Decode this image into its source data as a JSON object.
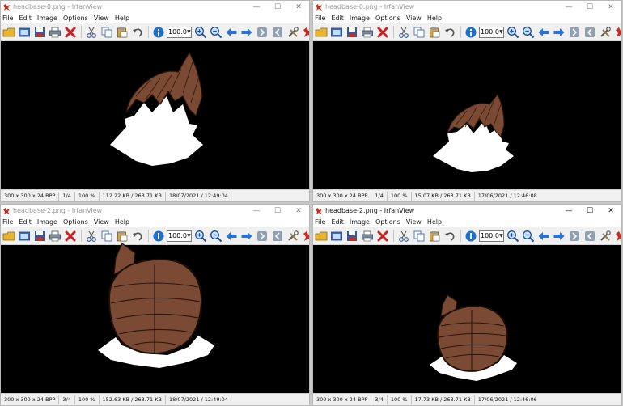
{
  "windows": [
    {
      "title": "headbase-0.png - IrfanView",
      "active": false,
      "menu": [
        "File",
        "Edit",
        "Image",
        "Options",
        "View",
        "Help"
      ],
      "zoom": "100.0",
      "status": {
        "dimensions": "300 x 300 x 24 BPP",
        "index": "1/4",
        "zoom": "100 %",
        "size": "112.22 KB / 263.71 KB",
        "date": "18/07/2021 / 12:49:04"
      }
    },
    {
      "title": "headbase-0.png - IrfanView",
      "active": false,
      "menu": [
        "File",
        "Edit",
        "Image",
        "Options",
        "View",
        "Help"
      ],
      "zoom": "100.0",
      "status": {
        "dimensions": "300 x 300 x 24 BPP",
        "index": "1/4",
        "zoom": "100 %",
        "size": "15.07 KB / 263.71 KB",
        "date": "17/06/2021 / 12:46:08"
      }
    },
    {
      "title": "headbase-2.png - IrfanView",
      "active": false,
      "menu": [
        "File",
        "Edit",
        "Image",
        "Options",
        "View",
        "Help"
      ],
      "zoom": "100.0",
      "status": {
        "dimensions": "300 x 300 x 24 BPP",
        "index": "3/4",
        "zoom": "100 %",
        "size": "152.63 KB / 263.71 KB",
        "date": "18/07/2021 / 12:49:04"
      }
    },
    {
      "title": "headbase-2.png - IrfanView",
      "active": true,
      "menu": [
        "File",
        "Edit",
        "Image",
        "Options",
        "View",
        "Help"
      ],
      "zoom": "100.0",
      "status": {
        "dimensions": "300 x 300 x 24 BPP",
        "index": "3/4",
        "zoom": "100 %",
        "size": "17.73 KB / 263.71 KB",
        "date": "17/06/2021 / 12:46:06"
      }
    }
  ],
  "caption_buttons": {
    "minimize": "—",
    "maximize": "☐",
    "close": "✕"
  },
  "toolbar_icons": [
    "open-folder-icon",
    "slideshow-icon",
    "save-icon",
    "print-icon",
    "delete-icon",
    "cut-icon",
    "copy-icon",
    "paste-icon",
    "undo-icon",
    "info-icon",
    "zoom-in-icon",
    "zoom-out-icon",
    "previous-icon",
    "next-icon",
    "first-icon",
    "last-icon",
    "tools-icon",
    "irfanview-logo-icon"
  ],
  "colors": {
    "canvas": "#000000",
    "hair": "#7a4a34",
    "skin": "#ffffff",
    "accent": "#cc2a1e"
  }
}
